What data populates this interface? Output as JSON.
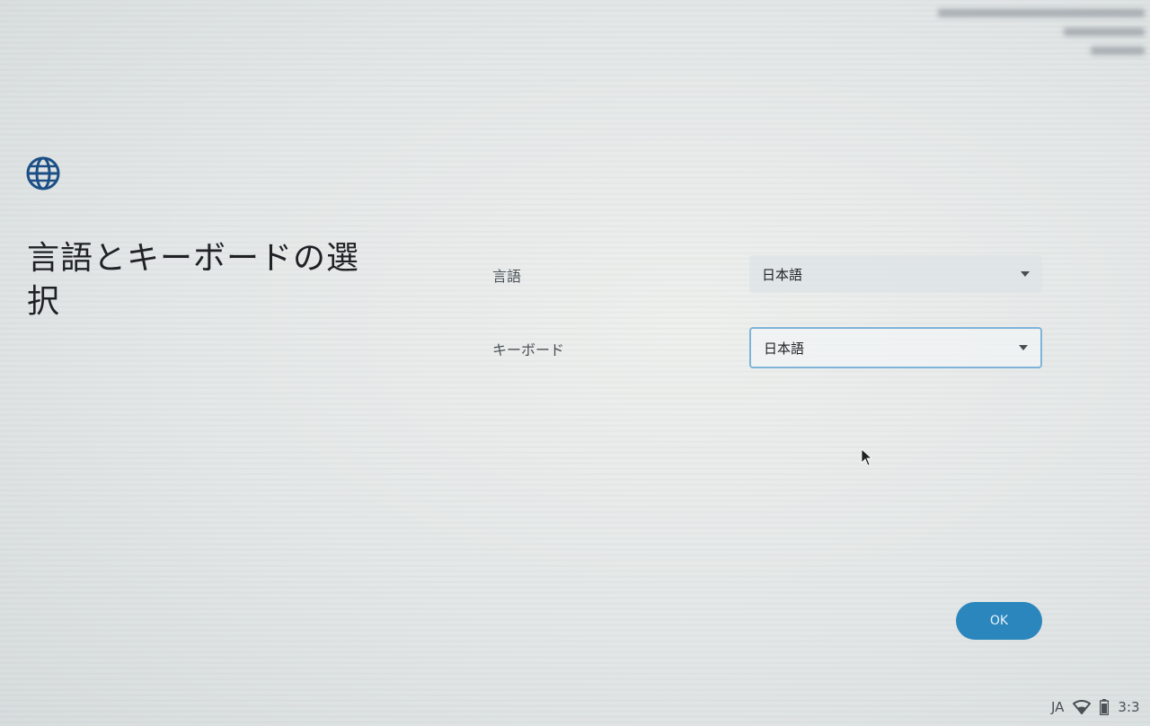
{
  "page": {
    "title": "言語とキーボードの選択"
  },
  "form": {
    "language": {
      "label": "言語",
      "value": "日本語"
    },
    "keyboard": {
      "label": "キーボード",
      "value": "日本語"
    }
  },
  "actions": {
    "ok_label": "OK"
  },
  "status_tray": {
    "input_method": "JA",
    "wifi_icon": "wifi-icon",
    "battery_icon": "battery-icon",
    "time": "3:3"
  },
  "icons": {
    "header": "globe-icon"
  },
  "colors": {
    "accent": "#2a86bd",
    "icon": "#1c4f86",
    "focus_border": "#7fb4d8"
  }
}
